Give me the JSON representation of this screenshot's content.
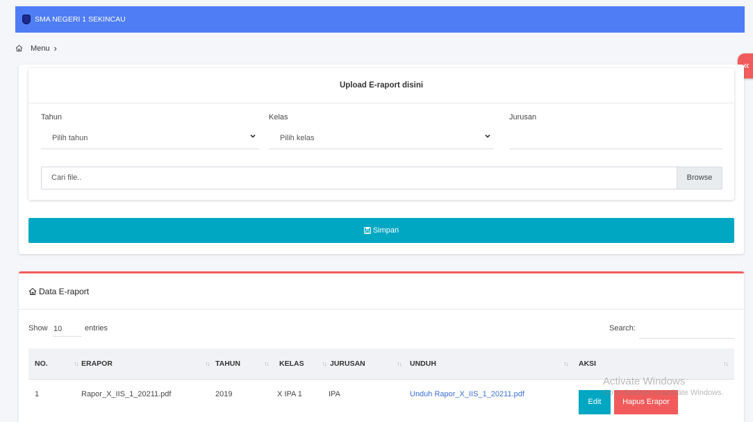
{
  "app": {
    "title": "SMA NEGERI 1 SEKINCAU"
  },
  "breadcrumb": {
    "menu_label": "Menu",
    "separator": "›"
  },
  "sidebar_toggle": {
    "glyph": "«"
  },
  "upload": {
    "title": "Upload E-raport disini",
    "tahun": {
      "label": "Tahun",
      "value": "Pilih tahun"
    },
    "kelas": {
      "label": "Kelas",
      "value": "Pilih kelas"
    },
    "jurusan": {
      "label": "Jurusan",
      "value": ""
    },
    "file": {
      "placeholder": "Cari file..",
      "browse_label": "Browse"
    },
    "save_label": "Simpan"
  },
  "table_card": {
    "title": "Data E-raport",
    "show_label": "Show",
    "page_length": "10",
    "entries_label": "entries",
    "search_label": "Search:",
    "sort_glyph": "↑↓",
    "columns": [
      "NO.",
      "ERAPOR",
      "TAHUN",
      "KELAS",
      "JURUSAN",
      "UNDUH",
      "AKSI"
    ],
    "rows": [
      {
        "no": "1",
        "erapor": "Rapor_X_IIS_1_20211.pdf",
        "tahun": "2019",
        "kelas": "X IPA 1",
        "jurusan": "IPA",
        "unduh": "Unduh Rapor_X_IIS_1_20211.pdf",
        "edit_label": "Edit",
        "delete_label": "Hapus Erapor"
      }
    ]
  },
  "watermark": {
    "line1": "Activate Windows",
    "line2": "Go to Settings to activate Windows."
  },
  "colors": {
    "topbar": "#4f7df5",
    "primary": "#00a7c2",
    "danger": "#f25b5b",
    "link": "#3b6fd8"
  }
}
